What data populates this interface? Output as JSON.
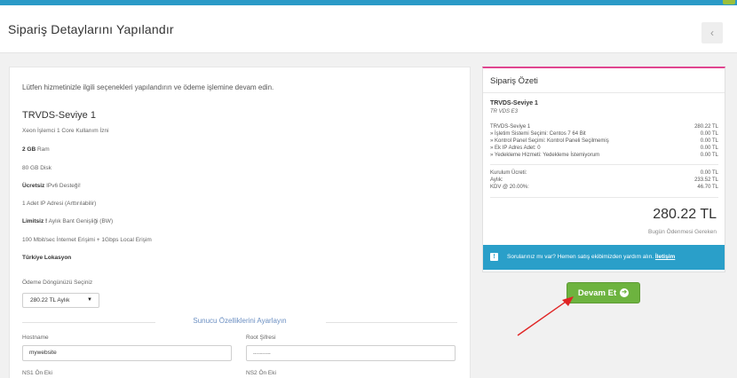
{
  "header": {
    "title": "Sipariş Detaylarını Yapılandır",
    "back_icon": "‹"
  },
  "config": {
    "intro": "Lütfen hizmetinizle ilgili seçenekleri yapılandırın ve ödeme işlemine devam edin.",
    "product_name": "TRVDS-Seviye 1",
    "features": [
      {
        "bold": "",
        "text": "Xeon İşlemci 1 Core Kullanım İzni"
      },
      {
        "bold": "2 GB",
        "text": " Ram"
      },
      {
        "bold": "",
        "text": "80 GB Disk"
      },
      {
        "bold": "Ücretsiz",
        "text": " IPv6 Desteği!"
      },
      {
        "bold": "",
        "text": "1 Adet IP Adresi (Arttırılabilir)"
      },
      {
        "bold": "Limitsiz !",
        "text": " Aylık Bant Genişliği (BW)"
      },
      {
        "bold": "",
        "text": "100 Mbit/sec İnternet Erişimi + 1Gbps Local Erişim"
      },
      {
        "bold": "Türkiye Lokasyon",
        "text": ""
      }
    ],
    "billing_cycle_label": "Ödeme Döngünüzü Seçiniz",
    "billing_cycle_value": "280.22 TL Aylık",
    "caret": "▼",
    "server_section_title": "Sunucu Özelliklerini Ayarlayın",
    "hostname_label": "Hostname",
    "hostname_value": "mywebsite",
    "root_password_label": "Root Şifresi",
    "root_password_value": "...........",
    "ns1_label": "NS1 Ön Eki",
    "ns2_label": "NS2 Ön Eki"
  },
  "summary": {
    "title": "Sipariş Özeti",
    "product": "TRVDS-Seviye 1",
    "group": "TR VDS E3",
    "lines": [
      {
        "label": "TRVDS-Seviye 1",
        "value": "280.22 TL"
      },
      {
        "label": "» İşletim Sistemi Seçimi: Centos 7 64 Bit",
        "value": "0.00 TL"
      },
      {
        "label": "» Kontrol Panel Seçimi: Kontrol Paneli Seçilmemiş",
        "value": "0.00 TL"
      },
      {
        "label": "» Ek IP Adres Adet: 0",
        "value": "0.00 TL"
      },
      {
        "label": "» Yedekleme Hizmeti: Yedekleme İstemiyorum",
        "value": "0.00 TL"
      }
    ],
    "fees": [
      {
        "label": "Kurulum Ücreti:",
        "value": "0.00 TL"
      },
      {
        "label": "Aylık:",
        "value": "233.52 TL"
      },
      {
        "label": "KDV @ 20.00%:",
        "value": "46.70 TL"
      }
    ],
    "total": "280.22 TL",
    "total_label": "Bugün Ödenmesi Gereken",
    "help_icon": "!",
    "help_text": "Sorularınız mı var? Hemen satış ekibimizden yardım alın. ",
    "help_link": "İletişim"
  },
  "actions": {
    "continue_label": "Devam Et",
    "continue_icon": "➔"
  },
  "colors": {
    "topbar": "#2a9ac7",
    "summary_accent": "#e0458f",
    "help_bar": "#2a9fc9",
    "continue_button": "#6db33f",
    "annotation_arrow": "#e02424"
  }
}
